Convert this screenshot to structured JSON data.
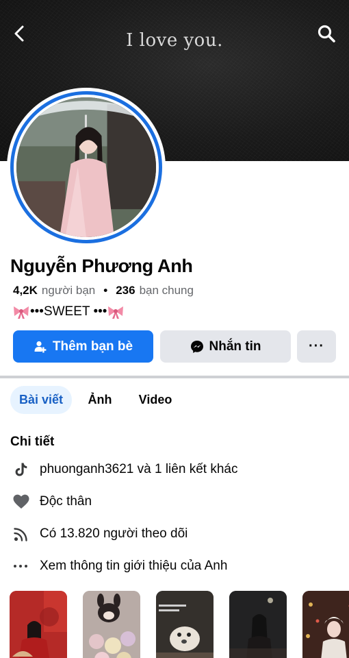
{
  "header": {
    "cover_text": "I love you.",
    "back_icon": "chevron-left-icon",
    "search_icon": "search-icon"
  },
  "profile": {
    "name": "Nguyễn Phương Anh",
    "friends_count": "4,2K",
    "friends_label": "người bạn",
    "mutual_count": "236",
    "mutual_label": "bạn chung",
    "bio_text": "•••SWEET •••",
    "bio_decoration_icon": "pink-bow-icon"
  },
  "actions": {
    "add_friend_label": "Thêm bạn bè",
    "message_label": "Nhắn tin",
    "more_label": "···"
  },
  "tabs": [
    {
      "label": "Bài viết",
      "active": true
    },
    {
      "label": "Ảnh",
      "active": false
    },
    {
      "label": "Video",
      "active": false
    }
  ],
  "details": {
    "title": "Chi tiết",
    "rows": [
      {
        "icon": "tiktok-icon",
        "text": "phuonganh3621 và 1 liên kết khác"
      },
      {
        "icon": "heart-icon",
        "text": "Độc thân"
      },
      {
        "icon": "rss-feed-icon",
        "text": "Có 13.820 người theo dõi"
      },
      {
        "icon": "more-dots-icon",
        "text": "Xem thông tin giới thiệu của Anh"
      }
    ]
  },
  "colors": {
    "accent": "#1877f2",
    "tab_active_bg": "#e7f3ff",
    "tab_active_text": "#1860c4",
    "secondary_button": "#e4e6eb",
    "avatar_ring": "#1b6fe0"
  }
}
